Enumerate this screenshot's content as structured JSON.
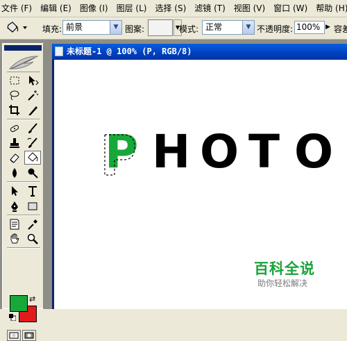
{
  "menu": [
    "文件 (F)",
    "编辑 (E)",
    "图像 (I)",
    "图层 (L)",
    "选择 (S)",
    "滤镜 (T)",
    "视图 (V)",
    "窗口 (W)",
    "帮助 (H)"
  ],
  "options_bar": {
    "fill_label": "填充:",
    "fill_value": "前景",
    "pattern_label": "图案:",
    "mode_label": "模式:",
    "mode_value": "正常",
    "opacity_label": "不透明度:",
    "opacity_value": "100%",
    "tolerance_label": "容差"
  },
  "document": {
    "title": "未标题-1 @ 100% (P, RGB/8)",
    "canvas_letters": [
      "P",
      "H",
      "O",
      "T",
      "O"
    ],
    "selected_letter_index": 0
  },
  "colors": {
    "foreground": "#18a83a",
    "background": "#e11b1b",
    "selection": "#18a83a",
    "titlebar": "#0040c0"
  },
  "tools": [
    "rect-marquee-icon",
    "move-icon",
    "lasso-icon",
    "magic-wand-icon",
    "crop-icon",
    "slice-icon",
    "healing-brush-icon",
    "brush-icon",
    "clone-stamp-icon",
    "history-brush-icon",
    "eraser-icon",
    "paint-bucket-icon",
    "blur-icon",
    "dodge-icon",
    "path-select-icon",
    "type-icon",
    "pen-icon",
    "shape-icon",
    "notes-icon",
    "eyedropper-icon",
    "hand-icon",
    "zoom-icon"
  ],
  "active_tool": "paint-bucket-icon",
  "watermark": {
    "brand": "百科全说",
    "tagline": "助你轻松解决"
  }
}
